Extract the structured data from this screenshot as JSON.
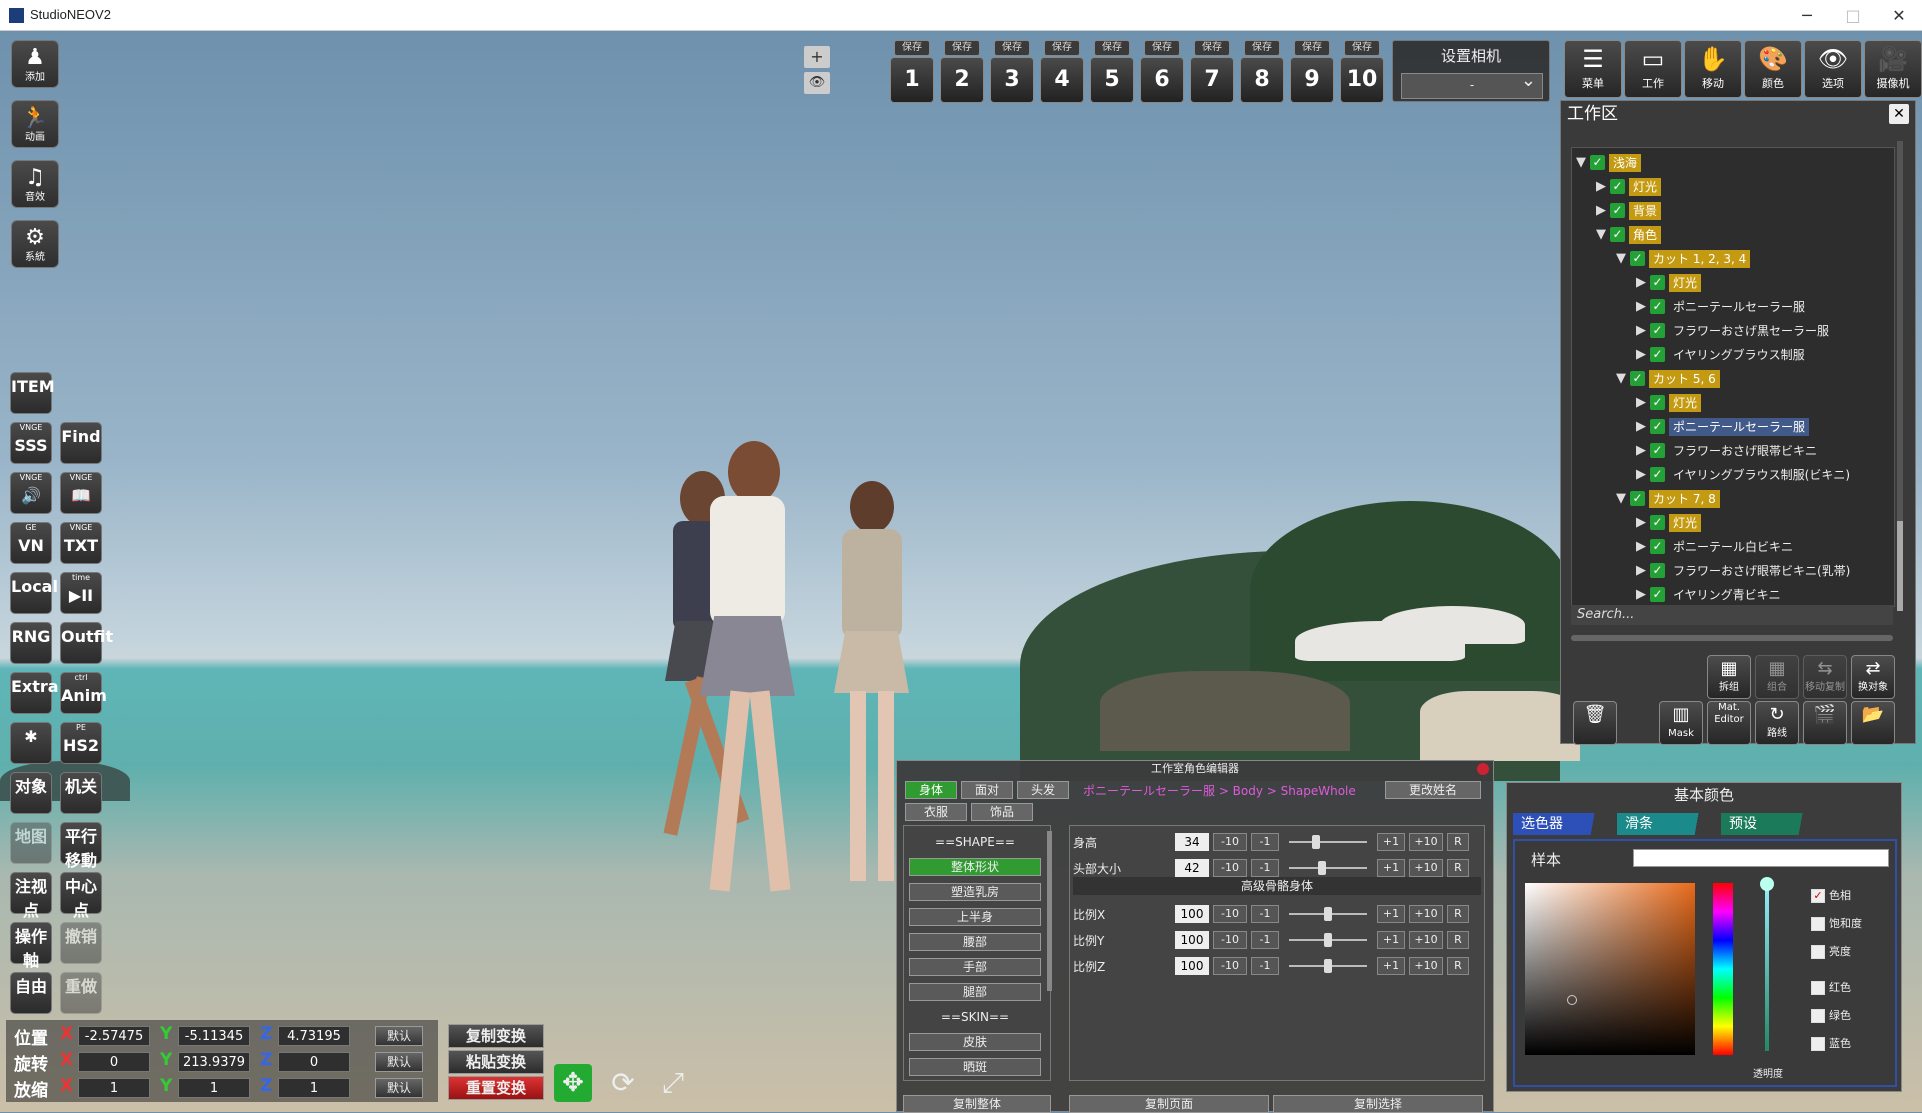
{
  "window": {
    "title": "StudioNEOV2",
    "minimize": "─",
    "maximize": "□",
    "close": "✕"
  },
  "left_tools": [
    {
      "label": "添加",
      "icon": "add-character-icon",
      "glyph": "♟"
    },
    {
      "label": "动画",
      "icon": "animation-icon",
      "glyph": "🏃"
    },
    {
      "label": "音效",
      "icon": "music-icon",
      "glyph": "♫"
    },
    {
      "label": "系統",
      "icon": "system-gear-icon",
      "glyph": "⚙"
    }
  ],
  "plugin_tools": [
    {
      "top": "ITEM",
      "bottom": ""
    },
    {
      "top": "SSS",
      "bottom": "VNGE"
    },
    {
      "top": "Find",
      "bottom": ""
    },
    {
      "top": "🔊",
      "bottom": "VNGE"
    },
    {
      "top": "📖",
      "bottom": "VNGE"
    },
    {
      "top": "VN",
      "bottom": "GE"
    },
    {
      "top": "TXT",
      "bottom": "VNGE"
    },
    {
      "top": "Local",
      "bottom": ""
    },
    {
      "top": "▶II",
      "bottom": "time"
    },
    {
      "top": "RNG",
      "bottom": ""
    },
    {
      "top": "Outfit",
      "bottom": ""
    },
    {
      "top": "Extra",
      "bottom": ""
    },
    {
      "top": "Anim",
      "bottom": "ctrl"
    },
    {
      "top": "✱",
      "bottom": ""
    },
    {
      "top": "HS2",
      "bottom": "PE"
    },
    {
      "top": "对象",
      "bottom": ""
    },
    {
      "top": "机关",
      "bottom": ""
    },
    {
      "top": "地图",
      "bottom": ""
    },
    {
      "top": "平行移動",
      "bottom": ""
    },
    {
      "top": "注视点",
      "bottom": ""
    },
    {
      "top": "中心点",
      "bottom": ""
    },
    {
      "top": "操作軸",
      "bottom": ""
    },
    {
      "top": "撤销",
      "bottom": ""
    },
    {
      "top": "自由",
      "bottom": ""
    },
    {
      "top": "重做",
      "bottom": ""
    }
  ],
  "save_slots": {
    "caption": "保存",
    "numbers": [
      "1",
      "2",
      "3",
      "4",
      "5",
      "6",
      "7",
      "8",
      "9",
      "10"
    ]
  },
  "mini": {
    "plus": "+",
    "eye": "👁"
  },
  "camera": {
    "title": "设置相机",
    "value": "-",
    "chevron": "⌄"
  },
  "top_tools": [
    {
      "label": "菜单",
      "glyph": "☰"
    },
    {
      "label": "工作",
      "glyph": "▭"
    },
    {
      "label": "移动",
      "glyph": "✋"
    },
    {
      "label": "颜色",
      "glyph": "🎨"
    },
    {
      "label": "选项",
      "glyph": "👁"
    },
    {
      "label": "摄像机",
      "glyph": "🎥"
    }
  ],
  "workspace": {
    "title": "工作区",
    "close": "✕",
    "search_placeholder": "Search...",
    "nodes": [
      {
        "label": "浅海",
        "depth": 0,
        "arrow": "▼",
        "style": "gold"
      },
      {
        "label": "灯光",
        "depth": 1,
        "arrow": "▶",
        "style": "gold"
      },
      {
        "label": "背景",
        "depth": 1,
        "arrow": "▶",
        "style": "gold"
      },
      {
        "label": "角色",
        "depth": 1,
        "arrow": "▼",
        "style": "gold"
      },
      {
        "label": "カット 1, 2, 3, 4",
        "depth": 2,
        "arrow": "▼",
        "style": "gold"
      },
      {
        "label": "灯光",
        "depth": 3,
        "arrow": "▶",
        "style": "gold"
      },
      {
        "label": "ポニーテールセーラー服",
        "depth": 3,
        "arrow": "▶",
        "style": "plain"
      },
      {
        "label": "フラワーおさげ黒セーラー服",
        "depth": 3,
        "arrow": "▶",
        "style": "plain"
      },
      {
        "label": "イヤリングブラウス制服",
        "depth": 3,
        "arrow": "▶",
        "style": "plain"
      },
      {
        "label": "カット 5, 6",
        "depth": 2,
        "arrow": "▼",
        "style": "gold"
      },
      {
        "label": "灯光",
        "depth": 3,
        "arrow": "▶",
        "style": "gold"
      },
      {
        "label": "ポニーテールセーラー服",
        "depth": 3,
        "arrow": "▶",
        "style": "blue"
      },
      {
        "label": "フラワーおさげ眼帯ビキニ",
        "depth": 3,
        "arrow": "▶",
        "style": "plain"
      },
      {
        "label": "イヤリングブラウス制服(ビキニ)",
        "depth": 3,
        "arrow": "▶",
        "style": "plain"
      },
      {
        "label": "カット 7, 8",
        "depth": 2,
        "arrow": "▼",
        "style": "gold"
      },
      {
        "label": "灯光",
        "depth": 3,
        "arrow": "▶",
        "style": "gold"
      },
      {
        "label": "ポニーテール白ビキニ",
        "depth": 3,
        "arrow": "▶",
        "style": "plain"
      },
      {
        "label": "フラワーおさげ眼帯ビキニ(乳帯)",
        "depth": 3,
        "arrow": "▶",
        "style": "plain"
      },
      {
        "label": "イヤリング青ビキニ",
        "depth": 3,
        "arrow": "▶",
        "style": "plain"
      }
    ],
    "check": "✓",
    "buttons_row1": [
      {
        "label": "拆组",
        "glyph": "▦",
        "dim": false
      },
      {
        "label": "组合",
        "glyph": "▦",
        "dim": true
      },
      {
        "label": "移动复制",
        "glyph": "⇆",
        "dim": true
      },
      {
        "label": "换对象",
        "glyph": "⇄",
        "dim": false
      }
    ],
    "buttons_row2": [
      {
        "label": "",
        "glyph": "🗑",
        "dim": false
      },
      {
        "label": "Mask",
        "glyph": "▥",
        "dim": false
      },
      {
        "label": "Mat. Editor",
        "glyph": "",
        "dim": false
      },
      {
        "label": "路线",
        "glyph": "↻",
        "dim": false
      },
      {
        "label": "",
        "glyph": "🎬",
        "dim": false
      },
      {
        "label": "",
        "glyph": "📂",
        "dim": false
      }
    ]
  },
  "transform": {
    "rows": [
      {
        "label": "位置",
        "x": "-2.57475",
        "y": "-5.11345",
        "z": "4.73195"
      },
      {
        "label": "旋转",
        "x": "0",
        "y": "213.9379",
        "z": "0"
      },
      {
        "label": "放缩",
        "x": "1",
        "y": "1",
        "z": "1"
      }
    ],
    "axis_x": "X",
    "axis_y": "Y",
    "axis_z": "Z",
    "default_label": "默认",
    "copy": "复制变换",
    "paste": "粘贴变换",
    "reset": "重置变换",
    "move_glyph": "✥",
    "rotate_glyph": "⟳",
    "scale_glyph": "⤢"
  },
  "char_editor": {
    "title": "工作室角色编辑器",
    "tabs": [
      "身体",
      "面对",
      "头发"
    ],
    "tabs2": [
      "衣服",
      "饰品"
    ],
    "breadcrumb": "ポニーテールセーラー服 > Body > ShapeWhole",
    "rename": "更改姓名",
    "categories": [
      "==SHAPE==",
      "整体形状",
      "塑造乳房",
      "上半身",
      "腰部",
      "手部",
      "腿部",
      "==SKIN==",
      "皮肤",
      "晒斑"
    ],
    "sliders_top": [
      {
        "name": "身高",
        "value": "34",
        "pos": 0.34
      },
      {
        "name": "头部大小",
        "value": "42",
        "pos": 0.42
      }
    ],
    "bone_header": "高级骨骼身体",
    "sliders_bone": [
      {
        "name": "比例X",
        "value": "100",
        "pos": 0.5
      },
      {
        "name": "比例Y",
        "value": "100",
        "pos": 0.5
      },
      {
        "name": "比例Z",
        "value": "100",
        "pos": 0.5
      }
    ],
    "btn_m10": "-10",
    "btn_m1": "-1",
    "btn_p1": "+1",
    "btn_p10": "+10",
    "btn_r": "R",
    "footer": [
      "复制整体",
      "复制页面",
      "复制选择"
    ]
  },
  "color_panel": {
    "title": "基本颜色",
    "tabs": [
      "选色器",
      "滑条",
      "预设"
    ],
    "sample": "样本",
    "alpha": "透明度",
    "checks": [
      {
        "label": "色相",
        "checked": true
      },
      {
        "label": "饱和度",
        "checked": false
      },
      {
        "label": "亮度",
        "checked": false
      },
      {
        "label": "红色",
        "checked": false
      },
      {
        "label": "绿色",
        "checked": false
      },
      {
        "label": "蓝色",
        "checked": false
      }
    ],
    "check_mark": "✓"
  }
}
